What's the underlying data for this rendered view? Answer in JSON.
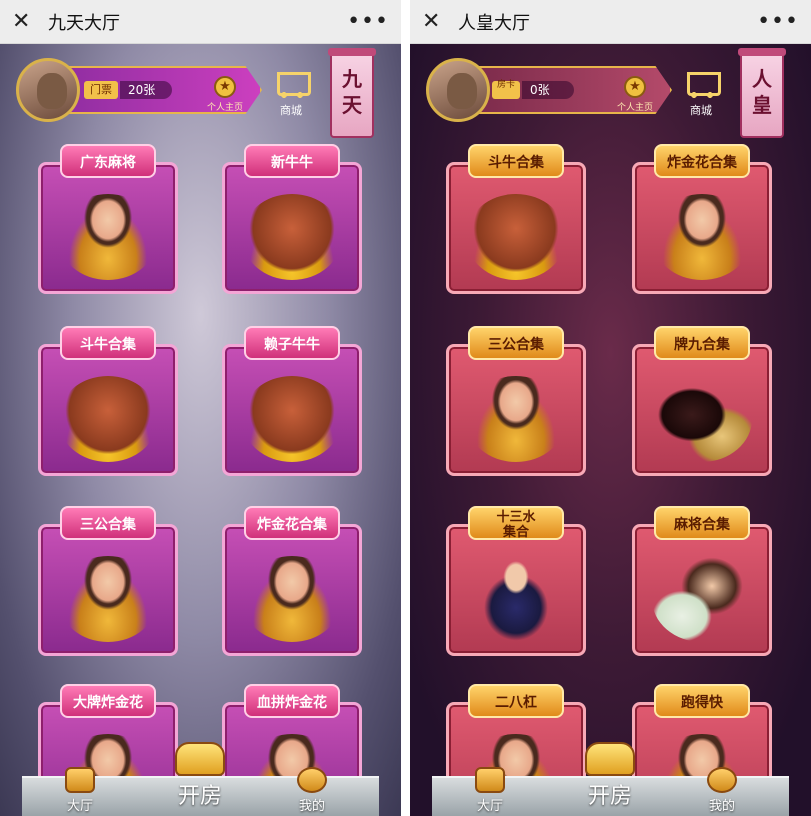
{
  "left": {
    "window_title": "九天大厅",
    "close_icon": "close-icon",
    "more_icon": "more-icon",
    "ticket": {
      "label": "门票",
      "value": "20张"
    },
    "homepage_label": "个人主页",
    "shop_label": "商城",
    "banner": [
      "九",
      "天"
    ],
    "games": [
      {
        "label": "广东麻将",
        "art": "girl"
      },
      {
        "label": "新牛牛",
        "art": "cow"
      },
      {
        "label": "斗牛合集",
        "art": "cow"
      },
      {
        "label": "赖子牛牛",
        "art": "cow"
      },
      {
        "label": "三公合集",
        "art": "girl"
      },
      {
        "label": "炸金花合集",
        "art": "girl"
      },
      {
        "label": "大牌炸金花",
        "art": "girl"
      },
      {
        "label": "血拼炸金花",
        "art": "girl"
      }
    ],
    "nav": {
      "hall": "大厅",
      "open_room": "开房",
      "mine": "我的"
    }
  },
  "right": {
    "window_title": "人皇大厅",
    "close_icon": "close-icon",
    "more_icon": "more-icon",
    "ticket": {
      "label": "房卡",
      "value": "0张"
    },
    "homepage_label": "个人主页",
    "shop_label": "商城",
    "banner": [
      "人",
      "皇"
    ],
    "games": [
      {
        "label": "斗牛合集",
        "art": "cow"
      },
      {
        "label": "炸金花合集",
        "art": "girl"
      },
      {
        "label": "三公合集",
        "art": "girl"
      },
      {
        "label": "牌九合集",
        "art": "dice"
      },
      {
        "label": "十三水\n集合",
        "art": "lady"
      },
      {
        "label": "麻将合集",
        "art": "tile-mj"
      },
      {
        "label": "二八杠",
        "art": "girl"
      },
      {
        "label": "跑得快",
        "art": "girl"
      }
    ],
    "nav": {
      "hall": "大厅",
      "open_room": "开房",
      "mine": "我的"
    }
  }
}
